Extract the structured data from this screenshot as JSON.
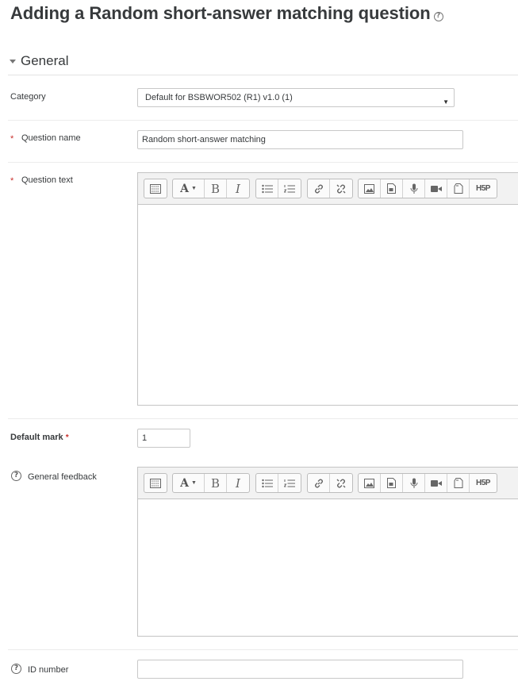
{
  "page": {
    "title": "Adding a Random short-answer matching question"
  },
  "general_section": {
    "title": "General"
  },
  "fields": {
    "category": {
      "label": "Category",
      "value": "Default for BSBWOR502 (R1) v1.0 (1)"
    },
    "question_name": {
      "label": "Question name",
      "value": "Random short-answer matching"
    },
    "question_text": {
      "label": "Question text",
      "value": ""
    },
    "default_mark": {
      "label": "Default mark",
      "value": "1"
    },
    "general_feedback": {
      "label": "General feedback",
      "value": ""
    },
    "id_number": {
      "label": "ID number",
      "value": ""
    }
  },
  "editor_toolbar": {
    "font_button": "A",
    "bold_button": "B",
    "italic_button": "I",
    "h5p_button": "H5P"
  },
  "icons": {
    "required": "*",
    "help": "?",
    "dropdown": "▼"
  },
  "colors": {
    "required": "#c9302c",
    "text": "#373a3c"
  }
}
